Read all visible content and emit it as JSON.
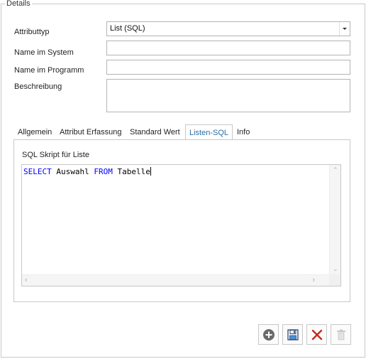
{
  "group": {
    "title": "Details"
  },
  "form": {
    "attributtyp": {
      "label": "Attributtyp",
      "value": "List (SQL)"
    },
    "name_system": {
      "label": "Name im System",
      "value": ""
    },
    "name_programm": {
      "label": "Name im Programm",
      "value": ""
    },
    "beschreibung": {
      "label": "Beschreibung",
      "value": ""
    }
  },
  "tabs": [
    {
      "label": "Allgemein"
    },
    {
      "label": "Attribut Erfassung"
    },
    {
      "label": "Standard Wert"
    },
    {
      "label": "Listen-SQL",
      "active": true
    },
    {
      "label": "Info"
    }
  ],
  "panel": {
    "label": "SQL Skript für Liste",
    "code": {
      "kw1": "SELECT",
      "t1": " Auswahl ",
      "kw2": "FROM",
      "t2": " Tabelle"
    }
  },
  "toolbar": {
    "add": {
      "icon": "plus-circle-icon"
    },
    "save": {
      "icon": "floppy-disk-icon"
    },
    "cancel": {
      "icon": "red-x-icon",
      "color": "#c42b1c"
    },
    "delete": {
      "icon": "trash-icon",
      "enabled": false
    }
  },
  "colors": {
    "accent": "#2e6da4",
    "keyword": "#0000ff",
    "border": "#c8c8c8"
  }
}
